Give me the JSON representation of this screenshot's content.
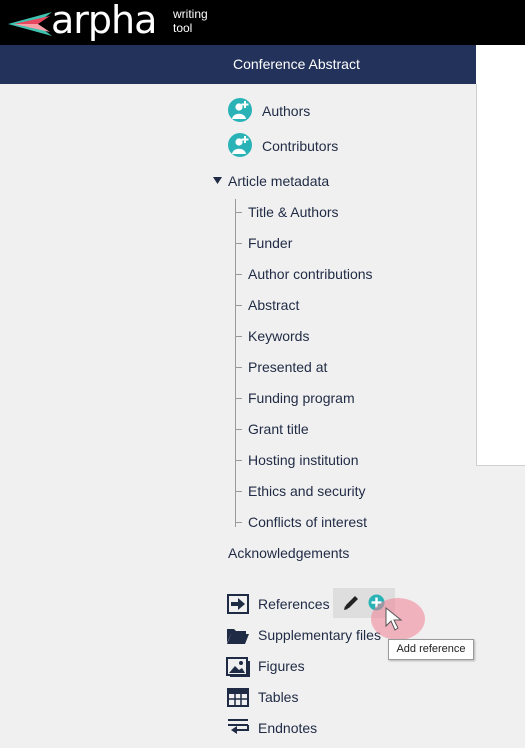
{
  "header": {
    "logo_text": "arpha",
    "tagline_line1": "writing",
    "tagline_line2": "tool"
  },
  "titlebar": {
    "title": "Conference Abstract"
  },
  "nav": {
    "authors": "Authors",
    "contributors": "Contributors",
    "article_metadata": "Article metadata",
    "metadata_items": [
      "Title & Authors",
      "Funder",
      "Author contributions",
      "Abstract",
      "Keywords",
      "Presented at",
      "Funding program",
      "Grant title",
      "Hosting institution",
      "Ethics and security",
      "Conflicts of interest"
    ],
    "acknowledgements": "Acknowledgements",
    "references": "References",
    "supplementary_files": "Supplementary files",
    "figures": "Figures",
    "tables": "Tables",
    "endnotes": "Endnotes"
  },
  "tooltip": {
    "add_reference": "Add reference"
  },
  "colors": {
    "header_bg": "#000000",
    "titlebar_bg": "#22325b",
    "accent_teal": "#2ab3b7",
    "sidebar_bg": "#f0f0f0"
  }
}
